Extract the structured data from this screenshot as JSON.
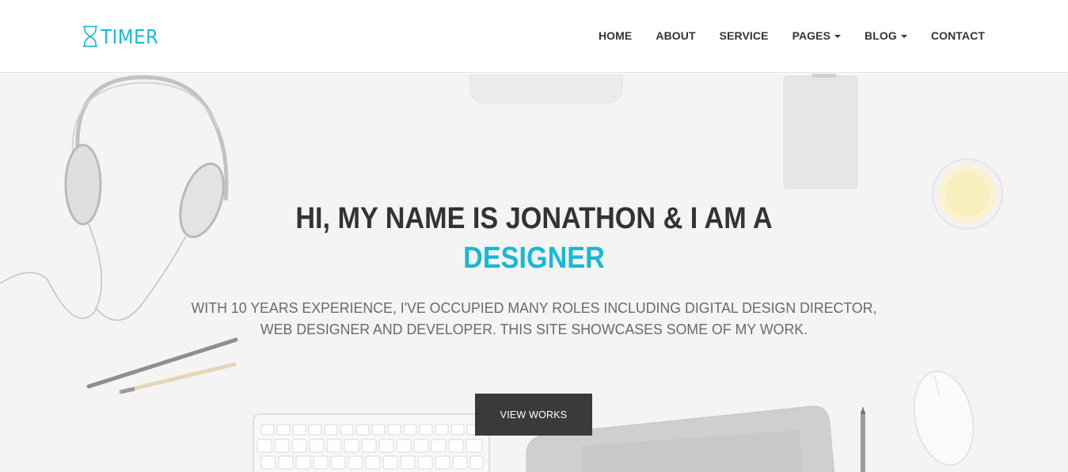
{
  "brand": {
    "name": "TIMER",
    "logo_icon": "hourglass-icon",
    "color": "#1bbcd2"
  },
  "nav": {
    "items": [
      {
        "label": "HOME",
        "dropdown": false
      },
      {
        "label": "ABOUT",
        "dropdown": false
      },
      {
        "label": "SERVICE",
        "dropdown": false
      },
      {
        "label": "PAGES",
        "dropdown": true
      },
      {
        "label": "BLOG",
        "dropdown": true
      },
      {
        "label": "CONTACT",
        "dropdown": false
      }
    ]
  },
  "hero": {
    "title_line1": "HI, MY NAME IS JONATHON & I AM A",
    "title_highlight": "DESIGNER",
    "subtitle_line1": "WITH 10 YEARS EXPERIENCE, I'VE OCCUPIED MANY ROLES INCLUDING DIGITAL DESIGN DIRECTOR,",
    "subtitle_line2": "WEB DESIGNER AND DEVELOPER. THIS SITE SHOWCASES SOME OF MY WORK.",
    "cta_label": "VIEW WORKS",
    "accent_color": "#1bb8cf",
    "button_color": "#3a3a3a"
  }
}
